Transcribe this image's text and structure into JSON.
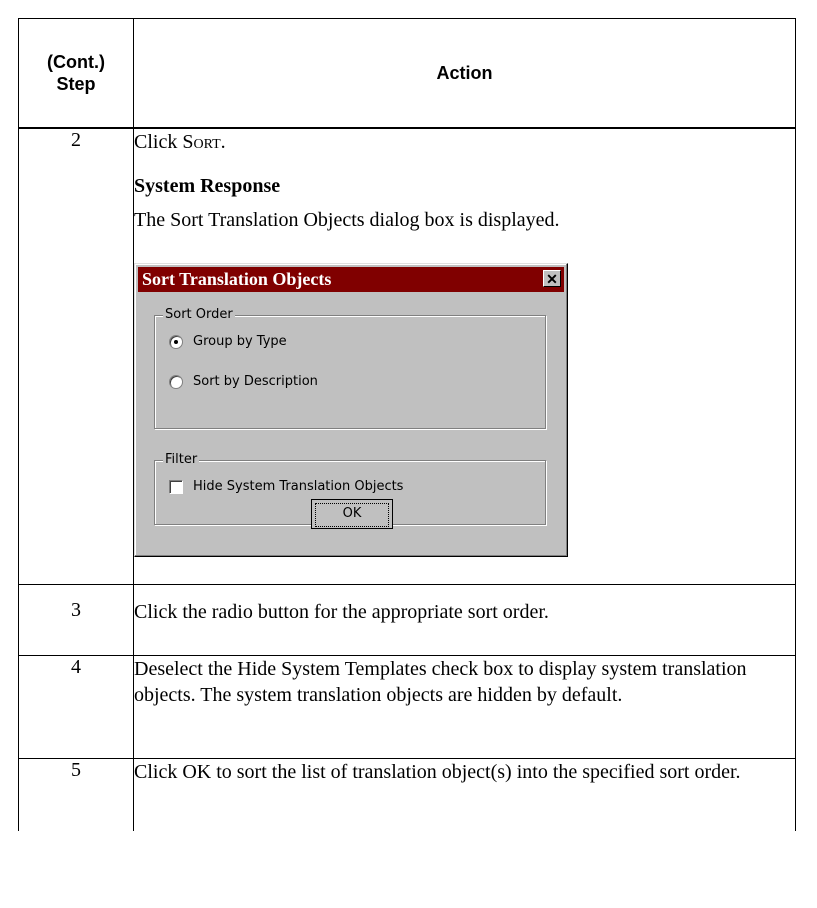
{
  "header": {
    "step": "(Cont.)\nStep",
    "step_line1": "(Cont.)",
    "step_line2": "Step",
    "action": "Action"
  },
  "rows": [
    {
      "step": "2",
      "action_prefix": "Click ",
      "action_sc": "Sort",
      "action_suffix": ".",
      "response_heading": "System Response",
      "response_text": "The Sort Translation Objects dialog box is displayed."
    },
    {
      "step": "3",
      "action": "Click the radio button for the appropriate sort order."
    },
    {
      "step": "4",
      "action": "Deselect the Hide System Templates check box to display system translation objects. The system translation objects are hidden by default."
    },
    {
      "step": "5",
      "action": "Click OK to sort the list of translation object(s) into the specified sort order."
    }
  ],
  "dialog": {
    "title": "Sort Translation Objects",
    "close_glyph": "✕",
    "sort_group": "Sort Order",
    "options": [
      {
        "label": "Group by Type",
        "selected": true
      },
      {
        "label": "Sort by Description",
        "selected": false
      }
    ],
    "filter_group": "Filter",
    "checkbox": {
      "label": "Hide System Translation Objects",
      "checked": false
    },
    "ok_label": "OK"
  },
  "colors": {
    "titlebar": "#800000",
    "dialog_bg": "#c0c0c0"
  }
}
